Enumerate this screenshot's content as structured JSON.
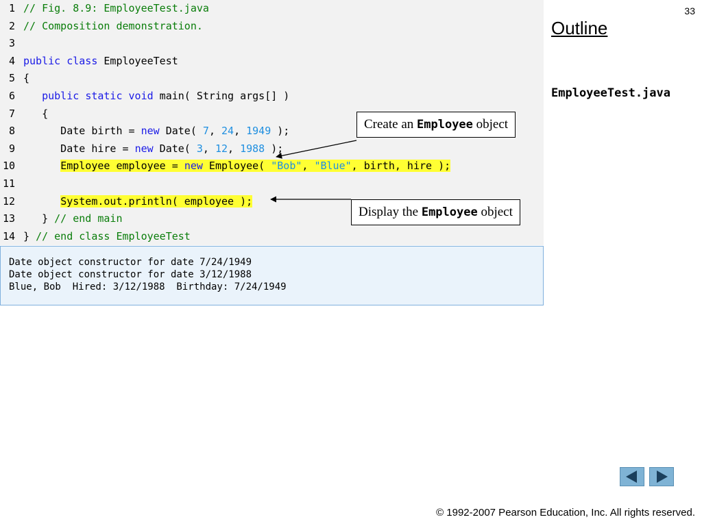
{
  "slide_number": "33",
  "outline_title": "Outline",
  "file_label": "EmployeeTest.java",
  "code": [
    {
      "n": "1",
      "segs": [
        {
          "t": "// Fig. 8.9: EmployeeTest.java",
          "c": "cm"
        }
      ]
    },
    {
      "n": "2",
      "segs": [
        {
          "t": "// Composition demonstration.",
          "c": "cm"
        }
      ]
    },
    {
      "n": "3",
      "segs": []
    },
    {
      "n": "4",
      "segs": [
        {
          "t": "public",
          "c": "kw"
        },
        {
          "t": " "
        },
        {
          "t": "class",
          "c": "kw"
        },
        {
          "t": " EmployeeTest"
        }
      ]
    },
    {
      "n": "5",
      "segs": [
        {
          "t": "{"
        }
      ]
    },
    {
      "n": "6",
      "segs": [
        {
          "t": "   "
        },
        {
          "t": "public",
          "c": "kw"
        },
        {
          "t": " "
        },
        {
          "t": "static",
          "c": "kw"
        },
        {
          "t": " "
        },
        {
          "t": "void",
          "c": "kw"
        },
        {
          "t": " main( String args[] )"
        }
      ]
    },
    {
      "n": "7",
      "segs": [
        {
          "t": "   {"
        }
      ]
    },
    {
      "n": "8",
      "segs": [
        {
          "t": "      Date birth = "
        },
        {
          "t": "new",
          "c": "kw"
        },
        {
          "t": " Date( "
        },
        {
          "t": "7",
          "c": "num"
        },
        {
          "t": ", "
        },
        {
          "t": "24",
          "c": "num"
        },
        {
          "t": ", "
        },
        {
          "t": "1949",
          "c": "num"
        },
        {
          "t": " );"
        }
      ]
    },
    {
      "n": "9",
      "segs": [
        {
          "t": "      Date hire = "
        },
        {
          "t": "new",
          "c": "kw"
        },
        {
          "t": " Date( "
        },
        {
          "t": "3",
          "c": "num"
        },
        {
          "t": ", "
        },
        {
          "t": "12",
          "c": "num"
        },
        {
          "t": ", "
        },
        {
          "t": "1988",
          "c": "num"
        },
        {
          "t": " );"
        }
      ]
    },
    {
      "n": "10",
      "segs": [
        {
          "t": "      "
        },
        {
          "t": "Employee employee = ",
          "c": "hl"
        },
        {
          "t": "new",
          "c": "kw hl"
        },
        {
          "t": " Employee( ",
          "c": "hl"
        },
        {
          "t": "\"Bob\"",
          "c": "str hl"
        },
        {
          "t": ", ",
          "c": "hl"
        },
        {
          "t": "\"Blue\"",
          "c": "str hl"
        },
        {
          "t": ", birth, hire );",
          "c": "hl"
        }
      ]
    },
    {
      "n": "11",
      "segs": []
    },
    {
      "n": "12",
      "segs": [
        {
          "t": "      "
        },
        {
          "t": "System.out.println( employee );",
          "c": "hl"
        }
      ]
    },
    {
      "n": "13",
      "segs": [
        {
          "t": "   } "
        },
        {
          "t": "// end main",
          "c": "cm"
        }
      ]
    },
    {
      "n": "14",
      "segs": [
        {
          "t": "} "
        },
        {
          "t": "// end class EmployeeTest",
          "c": "cm"
        }
      ]
    }
  ],
  "output_lines": [
    "Date object constructor for date 7/24/1949",
    "Date object constructor for date 3/12/1988",
    "Blue, Bob  Hired: 3/12/1988  Birthday: 7/24/1949"
  ],
  "callouts": {
    "create": {
      "pre": "Create an ",
      "code": "Employee",
      "post": " object"
    },
    "display": {
      "pre": "Display the ",
      "code": "Employee",
      "post": " object"
    }
  },
  "nav": {
    "prev": "prev-icon",
    "next": "next-icon",
    "color": "#7fb3d5"
  },
  "copyright": "© 1992-2007 Pearson Education, Inc.  All rights reserved."
}
